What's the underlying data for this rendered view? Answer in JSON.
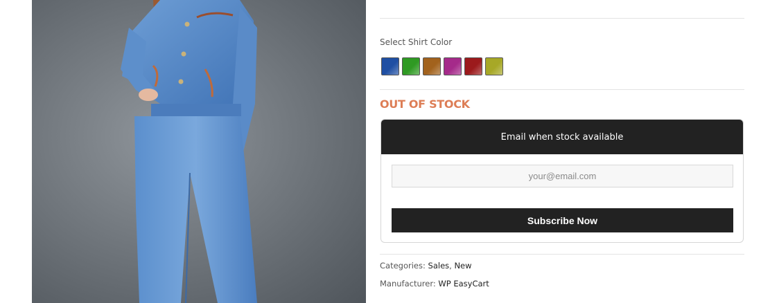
{
  "product": {
    "image_alt": "Woman wearing denim jacket and jeans"
  },
  "options": {
    "label": "Select Shirt Color",
    "swatches": [
      {
        "name": "Blue",
        "color": "#1f4fa3"
      },
      {
        "name": "Green",
        "color": "#2f9a23"
      },
      {
        "name": "Brown",
        "color": "#a2621d"
      },
      {
        "name": "Magenta",
        "color": "#a52a8a"
      },
      {
        "name": "Red",
        "color": "#9c1a1c"
      },
      {
        "name": "Olive",
        "color": "#a7a827"
      }
    ]
  },
  "stock": {
    "status": "OUT OF STOCK"
  },
  "notify": {
    "header": "Email when stock available",
    "email_placeholder": "your@email.com",
    "button_label": "Subscribe Now"
  },
  "meta": {
    "categories_label": "Categories:",
    "categories": [
      "Sales",
      "New"
    ],
    "manufacturer_label": "Manufacturer:",
    "manufacturer": "WP EasyCart"
  }
}
